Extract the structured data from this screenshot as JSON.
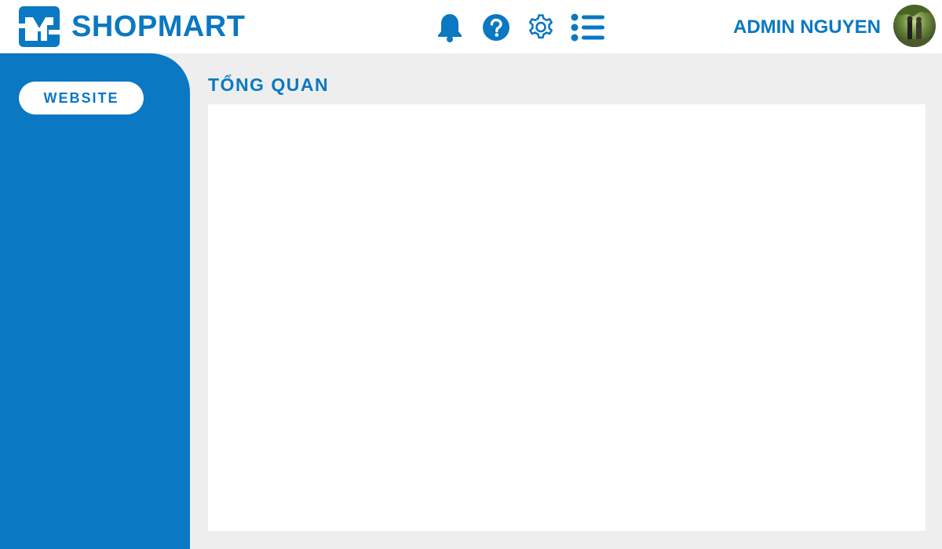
{
  "brand": {
    "name": "SHOPMART",
    "logo_icon": "shopmart-logo-icon",
    "color": "#0a78c2"
  },
  "toolbar": {
    "icons": [
      "bell-icon",
      "help-icon",
      "gear-icon",
      "list-icon"
    ]
  },
  "user": {
    "name": "ADMIN NGUYEN",
    "avatar_icon": "avatar-photo"
  },
  "sidebar": {
    "items": [
      {
        "label": "WEBSITE",
        "icon": ""
      }
    ]
  },
  "main": {
    "title": "TỔNG QUAN"
  },
  "colors": {
    "primary": "#0a78c2",
    "background": "#eeeeee",
    "panel": "#ffffff"
  }
}
